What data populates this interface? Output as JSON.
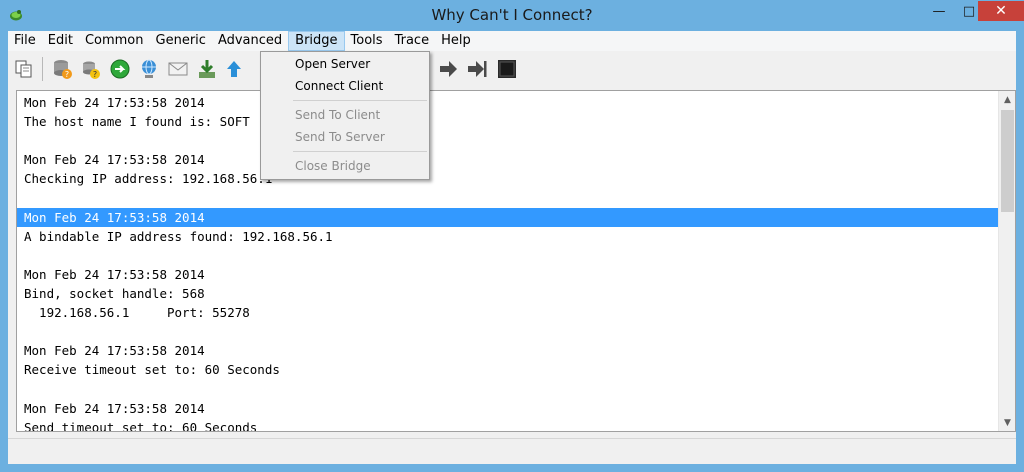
{
  "window": {
    "title": "Why Can't I Connect?",
    "minimize_glyph": "—",
    "maximize_glyph": "□",
    "close_glyph": "✕"
  },
  "menubar": {
    "items": [
      "File",
      "Edit",
      "Common",
      "Generic",
      "Advanced",
      "Bridge",
      "Tools",
      "Trace",
      "Help"
    ],
    "open_menu": "Bridge"
  },
  "bridge_menu": {
    "items": [
      {
        "label": "Open Server",
        "enabled": true
      },
      {
        "label": "Connect Client",
        "enabled": true
      },
      {
        "label": "Send To Client",
        "enabled": false
      },
      {
        "label": "Send To Server",
        "enabled": false
      },
      {
        "label": "Close Bridge",
        "enabled": false
      }
    ]
  },
  "toolbar": {
    "icons": [
      "copy-icon",
      "database-warning-icon",
      "database-help-icon",
      "globe-go-icon",
      "network-globe-icon",
      "mail-icon",
      "download-icon",
      "upload-arrow-icon",
      "arrow-right-icon",
      "step-end-icon",
      "stop-icon"
    ]
  },
  "log": {
    "lines": [
      "Mon Feb 24 17:53:58 2014",
      "The host name I found is: SOFT",
      "",
      "Mon Feb 24 17:53:58 2014",
      "Checking IP address: 192.168.56.1",
      "",
      "Mon Feb 24 17:53:58 2014",
      "A bindable IP address found: 192.168.56.1",
      "",
      "Mon Feb 24 17:53:58 2014",
      "Bind, socket handle: 568",
      "  192.168.56.1     Port: 55278",
      "",
      "Mon Feb 24 17:53:58 2014",
      "Receive timeout set to: 60 Seconds",
      "",
      "Mon Feb 24 17:53:58 2014",
      "Send timeout set to: 60 Seconds"
    ],
    "selected_index": 6
  },
  "colors": {
    "selection": "#3399ff",
    "titlebar": "#6cb0e0",
    "close_button": "#c7413a"
  }
}
